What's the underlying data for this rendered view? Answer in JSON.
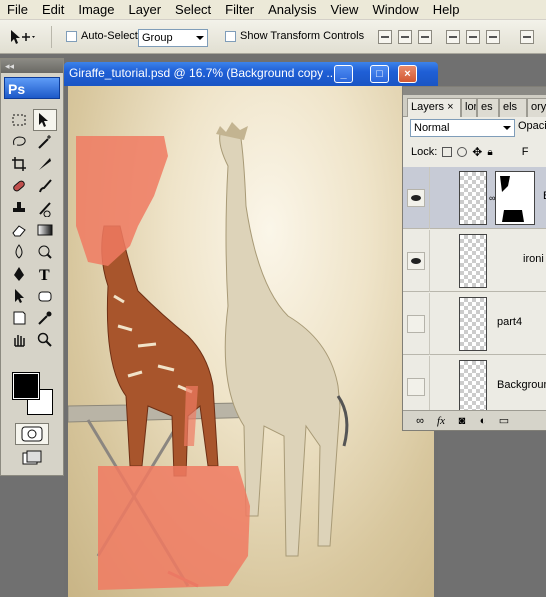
{
  "menu": [
    "File",
    "Edit",
    "Image",
    "Layer",
    "Select",
    "Filter",
    "Analysis",
    "View",
    "Window",
    "Help"
  ],
  "options": {
    "auto_select_label": "Auto-Select:",
    "auto_select_value": "Group",
    "transform_label": "Show Transform Controls"
  },
  "document": {
    "title": "Giraffe_tutorial.psd @ 16.7% (Background copy ..."
  },
  "tools": {
    "logo": "Ps",
    "items": [
      "rectangular-marquee",
      "move",
      "lasso",
      "magic-wand",
      "crop",
      "slice",
      "spot-healing",
      "brush",
      "clone-stamp",
      "history-brush",
      "eraser",
      "gradient",
      "blur",
      "dodge",
      "pen",
      "type",
      "path-selection",
      "shape",
      "notes",
      "eyedropper",
      "hand",
      "zoom"
    ],
    "foreground_color": "#000000",
    "background_color": "#ffffff"
  },
  "layers_panel": {
    "tabs": [
      "Layers",
      "lor",
      "es",
      "els",
      "ory"
    ],
    "blend_mode": "Normal",
    "opacity_label": "Opaci",
    "lock_label": "Lock:",
    "fill_label": "F",
    "layers": [
      {
        "name": "B",
        "visible": true,
        "has_mask": true
      },
      {
        "name": "ironi",
        "visible": true,
        "has_mask": false
      },
      {
        "name": "part4",
        "visible": false,
        "has_mask": false
      },
      {
        "name": "Background",
        "visible": false,
        "has_mask": false
      }
    ],
    "footer_icons": [
      "link-icon",
      "fx-icon",
      "mask-icon",
      "adjustment-icon",
      "folder-icon"
    ],
    "fx_label": "fx"
  },
  "colors": {
    "title_bar": "#1f5fd6",
    "mask_overlay": "#f07a62"
  }
}
